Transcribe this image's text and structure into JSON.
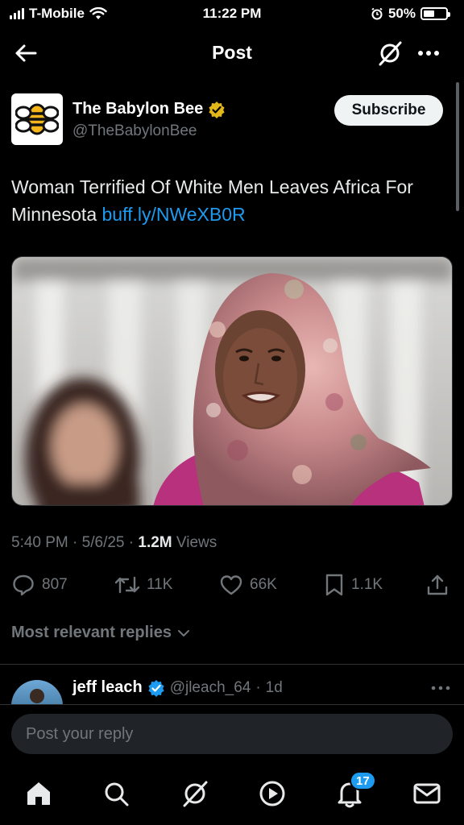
{
  "status_bar": {
    "carrier": "T-Mobile",
    "time": "11:22 PM",
    "battery": "50%",
    "battery_level": 0.5
  },
  "header": {
    "title": "Post"
  },
  "author": {
    "display_name": "The Babylon Bee",
    "handle": "@TheBabylonBee",
    "verified": true,
    "subscribe_label": "Subscribe"
  },
  "post": {
    "text": "Woman Terrified Of White Men Leaves Africa For Minnesota",
    "link": "buff.ly/NWeXB0R"
  },
  "meta": {
    "time": "5:40 PM",
    "date": "5/6/25",
    "views_count": "1.2M",
    "views_label": "Views"
  },
  "actions": {
    "replies": "807",
    "reposts": "11K",
    "likes": "66K",
    "bookmarks": "1.1K"
  },
  "replies_filter": {
    "label": "Most relevant replies"
  },
  "reply": {
    "name": "jeff leach",
    "handle": "@jleach_64",
    "time": "1d"
  },
  "composer": {
    "placeholder": "Post your reply"
  },
  "tabbar": {
    "notifications_badge": "17"
  },
  "colors": {
    "accent": "#1d9bf0",
    "background": "#000000",
    "verified_gold": "#e2b719"
  }
}
